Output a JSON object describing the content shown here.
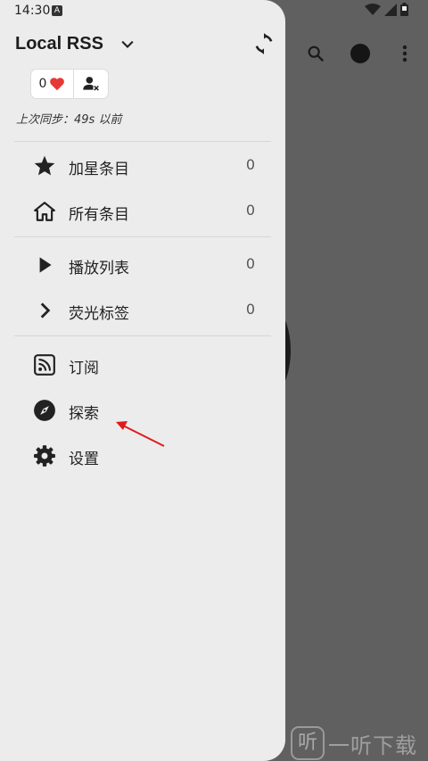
{
  "status_bar": {
    "time": "14:30",
    "notification_badge": "A"
  },
  "background_toolbar": {
    "icons": [
      "search-icon",
      "circle-avatar-icon",
      "more-vert-icon"
    ]
  },
  "drawer": {
    "title": "Local RSS",
    "chips": {
      "love_count": "0",
      "love_icon": "heart-icon",
      "user_icon": "user-remove-icon"
    },
    "last_sync": "上次同步：49s 以前",
    "sections": [
      {
        "items": [
          {
            "icon": "star-icon",
            "label": "加星条目",
            "count": "0"
          },
          {
            "icon": "home-icon",
            "label": "所有条目",
            "count": "0"
          }
        ]
      },
      {
        "items": [
          {
            "icon": "play-icon",
            "label": "播放列表",
            "count": "0"
          },
          {
            "icon": "chevron-right-icon",
            "label": "荧光标签",
            "count": "0"
          }
        ]
      },
      {
        "items": [
          {
            "icon": "rss-feed-icon",
            "label": "订阅"
          },
          {
            "icon": "explore-compass-icon",
            "label": "探索"
          },
          {
            "icon": "settings-gear-icon",
            "label": "设置"
          }
        ]
      }
    ]
  },
  "watermark": {
    "badge": "听",
    "text": "一听下载"
  },
  "colors": {
    "drawer_bg": "#ececec",
    "scrim": "#606060",
    "heart": "#e53935",
    "arrow": "#e01b1b"
  }
}
